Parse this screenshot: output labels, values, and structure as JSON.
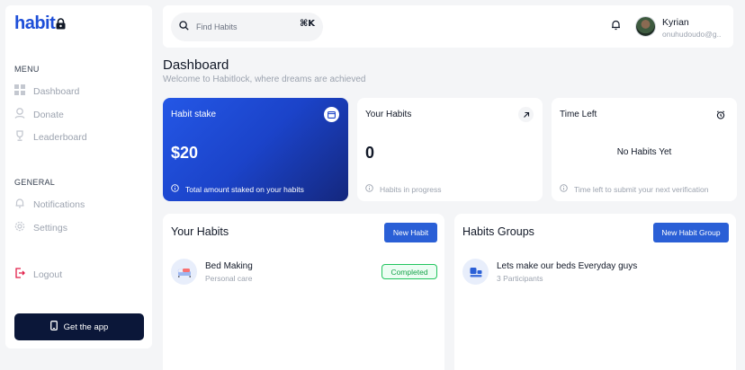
{
  "brand": {
    "logo_text": "habit"
  },
  "sidebar": {
    "menu_label": "MENU",
    "menu_items": [
      {
        "label": "Dashboard",
        "icon": "grid-icon"
      },
      {
        "label": "Donate",
        "icon": "donate-icon"
      },
      {
        "label": "Leaderboard",
        "icon": "trophy-icon"
      }
    ],
    "general_label": "GENERAL",
    "general_items": [
      {
        "label": "Notifications",
        "icon": "bell-icon"
      },
      {
        "label": "Settings",
        "icon": "gear-icon"
      }
    ],
    "logout_label": "Logout",
    "get_app_label": "Get the app"
  },
  "topbar": {
    "search_placeholder": "Find Habits",
    "shortcut": "⌘K",
    "user_name": "Kyrian",
    "user_email": "onuhudoudo@g..."
  },
  "header": {
    "title": "Dashboard",
    "subtitle": "Welcome to Habitlock, where dreams are achieved"
  },
  "cards": {
    "stake": {
      "title": "Habit stake",
      "value": "$20",
      "footer": "Total amount staked on your habits"
    },
    "habits": {
      "title": "Your Habits",
      "value": "0",
      "footer": "Habits in progress"
    },
    "time": {
      "title": "Time Left",
      "center": "No Habits Yet",
      "footer": "Time left to submit your next verification"
    }
  },
  "your_habits": {
    "title": "Your Habits",
    "button": "New Habit",
    "items": [
      {
        "name": "Bed Making",
        "category": "Personal care",
        "status": "Completed"
      }
    ]
  },
  "habit_groups": {
    "title": "Habits Groups",
    "button": "New Habit Group",
    "items": [
      {
        "name": "Lets make our beds Everyday guys",
        "participants": "3 Participants"
      }
    ]
  },
  "colors": {
    "accent": "#2a5fd6",
    "dark": "#0b1739",
    "success": "#16a34a"
  }
}
